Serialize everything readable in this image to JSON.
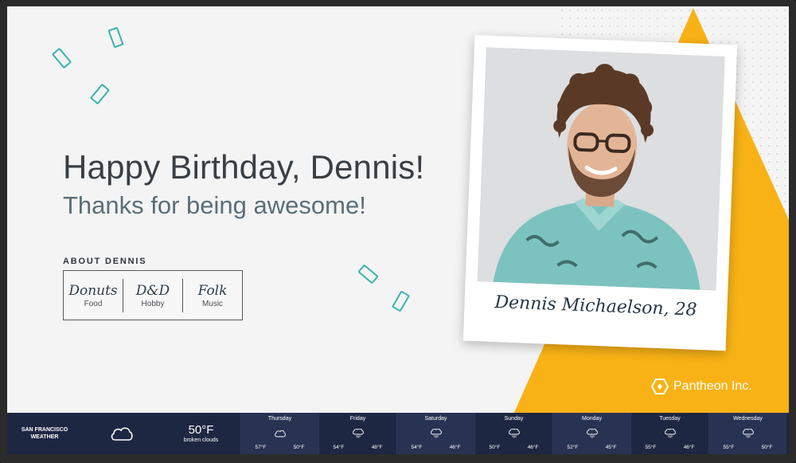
{
  "greeting": {
    "title": "Happy Birthday, Dennis!",
    "subtitle": "Thanks for being awesome!"
  },
  "about": {
    "label": "ABOUT DENNIS",
    "items": [
      {
        "value": "Donuts",
        "category": "Food"
      },
      {
        "value": "D&D",
        "category": "Hobby"
      },
      {
        "value": "Folk",
        "category": "Music"
      }
    ]
  },
  "polaroid": {
    "caption": "Dennis Michaelson, 28"
  },
  "brand": {
    "name": "Pantheon Inc.",
    "icon": "hexagon-logo-icon"
  },
  "weather": {
    "city_line1": "SAN FRANCISCO",
    "city_line2": "WEATHER",
    "current_icon": "cloud-icon",
    "current_temp": "50°F",
    "current_desc": "broken clouds",
    "forecast": [
      {
        "day": "Thursday",
        "icon": "cloud-icon",
        "low": "57°F",
        "high": "50°F"
      },
      {
        "day": "Friday",
        "icon": "rain-cloud-icon",
        "low": "54°F",
        "high": "48°F"
      },
      {
        "day": "Saturday",
        "icon": "rain-cloud-icon",
        "low": "54°F",
        "high": "46°F"
      },
      {
        "day": "Sunday",
        "icon": "rain-cloud-icon",
        "low": "50°F",
        "high": "46°F"
      },
      {
        "day": "Monday",
        "icon": "rain-cloud-icon",
        "low": "52°F",
        "high": "45°F"
      },
      {
        "day": "Tuesday",
        "icon": "rain-cloud-icon",
        "low": "55°F",
        "high": "46°F"
      },
      {
        "day": "Wednesday",
        "icon": "rain-cloud-icon",
        "low": "55°F",
        "high": "50°F"
      }
    ]
  },
  "colors": {
    "accent_yellow": "#f9b216",
    "confetti_teal": "#3bb3ad",
    "weather_bar": "#1e2742",
    "title_text": "#3a3f44"
  }
}
